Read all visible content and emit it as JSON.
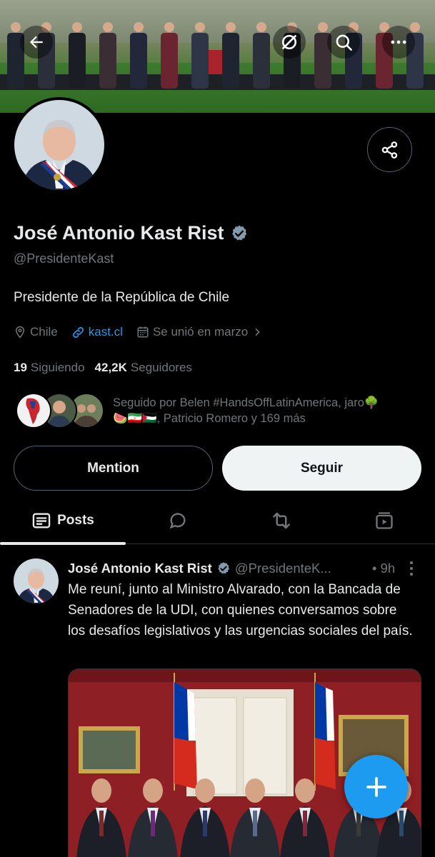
{
  "profile": {
    "display_name": "José Antonio Kast Rist",
    "handle": "@PresidenteKast",
    "bio": "Presidente de la República de Chile",
    "location": "Chile",
    "website": "kast.cl",
    "joined": "Se unió en marzo",
    "following_count": "19",
    "following_label": "Siguiendo",
    "followers_count": "42,2K",
    "followers_label": "Seguidores",
    "followed_by_line1": "Seguido por Belen #HandsOffLatinAmerica, jaro🌳",
    "followed_by_line2": "🍉🇮🇷🇵🇸, Patricio Romero y 169 más"
  },
  "actions": {
    "mention_label": "Mention",
    "follow_label": "Seguir"
  },
  "tabs": {
    "posts_label": "Posts"
  },
  "post": {
    "author": "José Antonio Kast Rist",
    "handle": "@PresidenteK...",
    "time": "• 9h",
    "text": "Me reuní, junto al Ministro Alvarado, con la Bancada de Senadores de la UDI, con quienes conversamos sobre los desafíos legislativos y las urgencias sociales del país."
  },
  "colors": {
    "accent": "#1d9bf0",
    "background": "#000000",
    "text": "#e7e9ea",
    "muted": "#71767b",
    "border": "#536471"
  },
  "icons": [
    "back-arrow-icon",
    "grok-icon",
    "search-icon",
    "more-icon",
    "share-icon",
    "verified-badge-icon",
    "location-icon",
    "link-icon",
    "calendar-icon",
    "chevron-right-icon",
    "posts-icon",
    "replies-icon",
    "repost-icon",
    "media-icon",
    "vertical-more-icon",
    "plus-icon"
  ]
}
